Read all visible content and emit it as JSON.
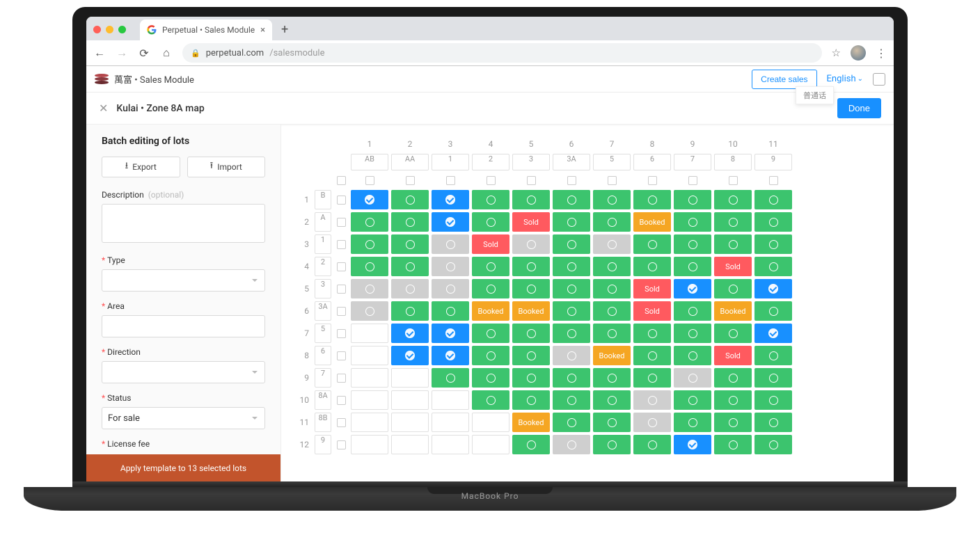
{
  "browser": {
    "tab_title": "Perpetual • Sales Module",
    "url_host": "perpetual.com",
    "url_path": "/salesmodule"
  },
  "header": {
    "brand": "萬富",
    "module": " • Sales Module",
    "create_sales": "Create sales",
    "language": "English",
    "lang_popup": "普通话"
  },
  "toolbar": {
    "close": "✕",
    "title": "Kulai • Zone 8A map",
    "done": "Done"
  },
  "sidebar": {
    "heading": "Batch editing of lots",
    "export": "Export",
    "import": "Import",
    "description_label": "Description",
    "description_opt": "(optional)",
    "type_label": "Type",
    "area_label": "Area",
    "direction_label": "Direction",
    "status_label": "Status",
    "status_value": "For sale",
    "license_label": "License fee",
    "apply_button": "Apply template to 13 selected lots"
  },
  "grid": {
    "col_nums": [
      "1",
      "2",
      "3",
      "4",
      "5",
      "6",
      "7",
      "8",
      "9",
      "10",
      "11"
    ],
    "col_heads": [
      "AB",
      "AA",
      "1",
      "2",
      "3",
      "3A",
      "5",
      "6",
      "7",
      "8",
      "9"
    ],
    "rows": [
      {
        "num": "1",
        "head": "B",
        "cells": [
          "blue-check",
          "green",
          "blue-check",
          "green",
          "green",
          "green",
          "green",
          "green",
          "green",
          "green",
          "green"
        ]
      },
      {
        "num": "2",
        "head": "A",
        "cells": [
          "green",
          "green",
          "blue-check",
          "green",
          "red-Sold",
          "green",
          "green",
          "orange-Booked",
          "green",
          "green",
          "green"
        ]
      },
      {
        "num": "3",
        "head": "1",
        "cells": [
          "green",
          "green",
          "grey",
          "red-Sold",
          "grey",
          "green",
          "grey",
          "green",
          "green",
          "green",
          "green"
        ]
      },
      {
        "num": "4",
        "head": "2",
        "cells": [
          "green",
          "green",
          "grey",
          "green",
          "green",
          "green",
          "green",
          "green",
          "green",
          "red-Sold",
          "green"
        ]
      },
      {
        "num": "5",
        "head": "3",
        "cells": [
          "grey",
          "grey",
          "grey",
          "green",
          "green",
          "green",
          "green",
          "red-Sold",
          "blue-check",
          "green",
          "blue-check"
        ]
      },
      {
        "num": "6",
        "head": "3A",
        "cells": [
          "grey",
          "green",
          "green",
          "orange-Booked",
          "orange-Booked",
          "green",
          "green",
          "red-Sold",
          "green",
          "orange-Booked",
          "green"
        ]
      },
      {
        "num": "7",
        "head": "5",
        "cells": [
          "white",
          "blue-check",
          "blue-check",
          "green",
          "green",
          "green",
          "green",
          "green",
          "green",
          "green",
          "blue-check"
        ]
      },
      {
        "num": "8",
        "head": "6",
        "cells": [
          "white",
          "blue-check",
          "blue-check",
          "green",
          "green",
          "grey",
          "orange-Booked",
          "green",
          "green",
          "red-Sold",
          "green"
        ]
      },
      {
        "num": "9",
        "head": "7",
        "cells": [
          "white",
          "white",
          "green",
          "green",
          "green",
          "green",
          "green",
          "green",
          "grey",
          "green",
          "green"
        ]
      },
      {
        "num": "10",
        "head": "8A",
        "cells": [
          "white",
          "white",
          "white",
          "green",
          "green",
          "green",
          "green",
          "grey",
          "green",
          "green",
          "green"
        ]
      },
      {
        "num": "11",
        "head": "8B",
        "cells": [
          "white",
          "white",
          "white",
          "white",
          "orange-Booked",
          "green",
          "green",
          "grey",
          "green",
          "green",
          "green"
        ]
      },
      {
        "num": "12",
        "head": "9",
        "cells": [
          "white",
          "white",
          "white",
          "white",
          "green",
          "grey",
          "green",
          "green",
          "blue-check",
          "green",
          "green"
        ]
      }
    ]
  }
}
